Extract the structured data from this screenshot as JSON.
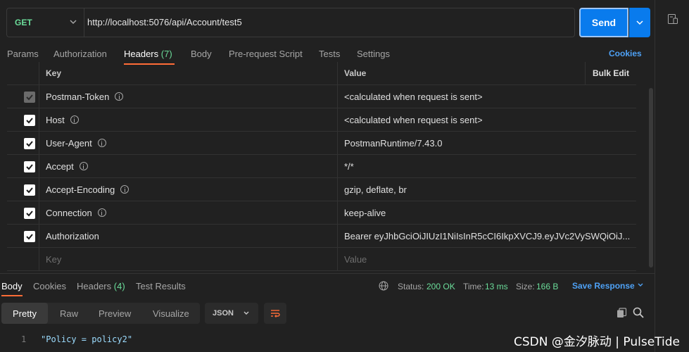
{
  "request": {
    "method": "GET",
    "url": "http://localhost:5076/api/Account/test5",
    "send_label": "Send"
  },
  "request_tabs": [
    {
      "label": "Params"
    },
    {
      "label": "Authorization"
    },
    {
      "label": "Headers",
      "count": "(7)"
    },
    {
      "label": "Body"
    },
    {
      "label": "Pre-request Script"
    },
    {
      "label": "Tests"
    },
    {
      "label": "Settings"
    }
  ],
  "cookies_label": "Cookies",
  "headers_table": {
    "key_header": "Key",
    "value_header": "Value",
    "bulk_edit": "Bulk Edit",
    "rows": [
      {
        "key": "Postman-Token",
        "value": "<calculated when request is sent>",
        "checked": true,
        "disabled": true
      },
      {
        "key": "Host",
        "value": "<calculated when request is sent>",
        "checked": true
      },
      {
        "key": "User-Agent",
        "value": "PostmanRuntime/7.43.0",
        "checked": true
      },
      {
        "key": "Accept",
        "value": "*/*",
        "checked": true
      },
      {
        "key": "Accept-Encoding",
        "value": "gzip, deflate, br",
        "checked": true
      },
      {
        "key": "Connection",
        "value": "keep-alive",
        "checked": true
      },
      {
        "key": "Authorization",
        "value": "Bearer eyJhbGciOiJIUzI1NiIsInR5cCI6IkpXVCJ9.eyJVc2VySWQiOiJ...",
        "checked": true
      }
    ],
    "key_placeholder": "Key",
    "value_placeholder": "Value"
  },
  "response": {
    "tabs": [
      {
        "label": "Body"
      },
      {
        "label": "Cookies"
      },
      {
        "label": "Headers",
        "count": "(4)"
      },
      {
        "label": "Test Results"
      }
    ],
    "status_label": "Status:",
    "status_value": "200 OK",
    "time_label": "Time:",
    "time_value": "13 ms",
    "size_label": "Size:",
    "size_value": "166 B",
    "save_label": "Save Response",
    "format_tabs": [
      "Pretty",
      "Raw",
      "Preview",
      "Visualize"
    ],
    "format_selected": "JSON",
    "line_number": "1",
    "body_line": "\"Policy = policy2\""
  },
  "watermark": "CSDN @金汐脉动 | PulseTide",
  "colors": {
    "accent": "#ff6c37",
    "send": "#097bed",
    "status": "#6bdd9a",
    "link": "#4ea1f5"
  }
}
